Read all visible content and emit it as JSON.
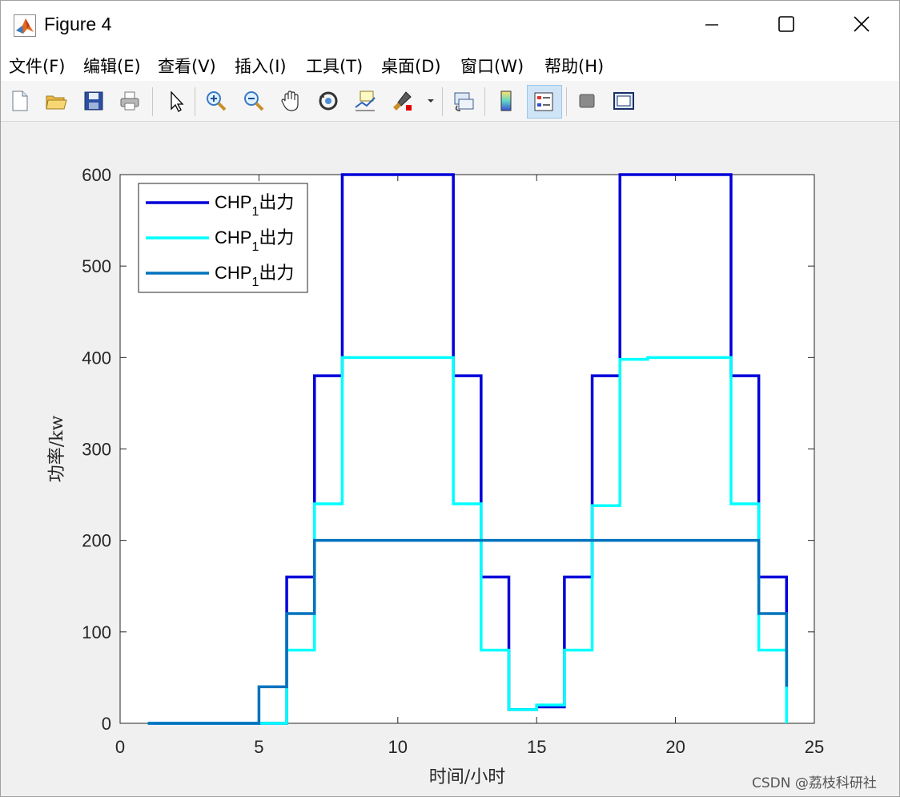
{
  "window": {
    "title": "Figure 4"
  },
  "menu": [
    "文件(F)",
    "编辑(E)",
    "查看(V)",
    "插入(I)",
    "工具(T)",
    "桌面(D)",
    "窗口(W)",
    "帮助(H)"
  ],
  "toolbar": {
    "buttons": [
      {
        "name": "new-figure",
        "icon": "new-file-icon"
      },
      {
        "name": "open-file",
        "icon": "folder-open-icon"
      },
      {
        "name": "save-figure",
        "icon": "save-icon"
      },
      {
        "name": "print-figure",
        "icon": "printer-icon"
      },
      {
        "name": "edit-plot",
        "icon": "pointer-arrow-icon"
      },
      {
        "name": "zoom-in",
        "icon": "zoom-in-icon"
      },
      {
        "name": "zoom-out",
        "icon": "zoom-out-icon"
      },
      {
        "name": "pan",
        "icon": "hand-icon"
      },
      {
        "name": "rotate-3d",
        "icon": "rotate-icon"
      },
      {
        "name": "data-cursor",
        "icon": "data-tip-icon"
      },
      {
        "name": "brush",
        "icon": "brush-icon"
      },
      {
        "name": "link-plot",
        "icon": "link-icon"
      },
      {
        "name": "insert-colorbar",
        "icon": "colorbar-icon"
      },
      {
        "name": "insert-legend",
        "icon": "legend-icon"
      },
      {
        "name": "hide-plot-tools",
        "icon": "hide-tools-icon"
      },
      {
        "name": "show-plot-tools",
        "icon": "show-tools-icon"
      }
    ]
  },
  "colors": {
    "series1": "#0000d9",
    "series2": "#00ffff",
    "series3": "#0072bd"
  },
  "chart_data": {
    "type": "line",
    "step": "post",
    "xlabel": "时间/小时",
    "ylabel": "功率/kw",
    "xlim": [
      0,
      25
    ],
    "ylim": [
      0,
      600
    ],
    "xticks": [
      0,
      5,
      10,
      15,
      20,
      25
    ],
    "yticks": [
      0,
      100,
      200,
      300,
      400,
      500,
      600
    ],
    "grid": false,
    "legend_position": "top-left",
    "x": [
      1,
      2,
      3,
      4,
      5,
      6,
      7,
      8,
      9,
      10,
      11,
      12,
      13,
      14,
      15,
      16,
      17,
      18,
      19,
      20,
      21,
      22,
      23,
      24
    ],
    "series": [
      {
        "name": "CHP1出力",
        "name_base": "CHP",
        "name_sub": "1",
        "name_suffix": "出力",
        "values": [
          0,
          0,
          0,
          0,
          0,
          160,
          380,
          600,
          600,
          600,
          600,
          380,
          160,
          15,
          18,
          160,
          380,
          600,
          600,
          600,
          600,
          380,
          160,
          40
        ]
      },
      {
        "name": "CHP1出力",
        "name_base": "CHP",
        "name_sub": "1",
        "name_suffix": "出力",
        "values": [
          0,
          0,
          0,
          0,
          0,
          80,
          240,
          400,
          400,
          400,
          400,
          240,
          80,
          15,
          20,
          80,
          238,
          398,
          400,
          400,
          400,
          240,
          80,
          0
        ]
      },
      {
        "name": "CHP1出力",
        "name_base": "CHP",
        "name_sub": "1",
        "name_suffix": "出力",
        "values": [
          0,
          0,
          0,
          0,
          40,
          120,
          200,
          200,
          200,
          200,
          200,
          200,
          200,
          200,
          200,
          200,
          200,
          200,
          200,
          200,
          200,
          200,
          120,
          40
        ]
      }
    ]
  },
  "watermark": "CSDN @荔枝科研社"
}
